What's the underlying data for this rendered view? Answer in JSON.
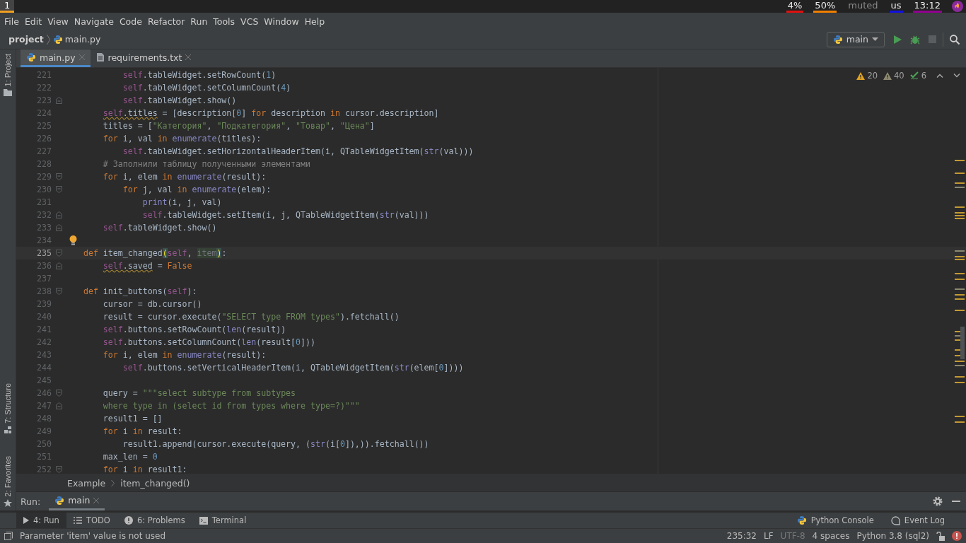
{
  "system_bar": {
    "workspaces": [
      {
        "label": "1",
        "selected": true
      }
    ],
    "indicators": [
      {
        "text": "4%",
        "color": "#e01010"
      },
      {
        "text": "50%",
        "color": "#f08000"
      },
      {
        "text": "muted"
      },
      {
        "text": "us",
        "color": "#1010e0"
      },
      {
        "text": "13:12",
        "color": "#900090"
      }
    ]
  },
  "menu": [
    "File",
    "Edit",
    "View",
    "Navigate",
    "Code",
    "Refactor",
    "Run",
    "Tools",
    "VCS",
    "Window",
    "Help"
  ],
  "nav": {
    "project": "project",
    "file": "main.py",
    "run_config": "main",
    "stop_disabled": true
  },
  "tabs": [
    {
      "label": "main.py",
      "kind": "python",
      "selected": true
    },
    {
      "label": "requirements.txt",
      "kind": "text",
      "selected": false
    }
  ],
  "left_stripe": [
    {
      "label": "1: Project",
      "kind": "project"
    },
    {
      "label": "7: Structure",
      "kind": "structure"
    },
    {
      "label": "2: Favorites",
      "kind": "favorites"
    }
  ],
  "inspections": [
    {
      "kind": "warning",
      "count": "20"
    },
    {
      "kind": "weak",
      "count": "40"
    },
    {
      "kind": "typo",
      "count": "6"
    }
  ],
  "code": [
    {
      "number": "221",
      "tokens": [
        {
          "kind": "self",
          "text": "            self"
        },
        {
          "kind": "plain",
          "text": ".tableWidget.setRowCount("
        },
        {
          "kind": "number",
          "text": "1"
        },
        {
          "kind": "plain",
          "text": ")"
        }
      ]
    },
    {
      "number": "222",
      "tokens": [
        {
          "kind": "self",
          "text": "            self"
        },
        {
          "kind": "plain",
          "text": ".tableWidget.setColumnCount("
        },
        {
          "kind": "number",
          "text": "4"
        },
        {
          "kind": "plain",
          "text": ")"
        }
      ]
    },
    {
      "number": "223",
      "fold_end": true,
      "tokens": [
        {
          "kind": "self",
          "text": "            self"
        },
        {
          "kind": "plain",
          "text": ".tableWidget.show()"
        }
      ]
    },
    {
      "number": "224",
      "tokens": [
        {
          "kind": "self",
          "text": "        self",
          "warning": true
        },
        {
          "kind": "plain",
          "text": ".titles",
          "warning": true
        },
        {
          "kind": "plain",
          "text": " = [description["
        },
        {
          "kind": "number",
          "text": "0"
        },
        {
          "kind": "plain",
          "text": "] "
        },
        {
          "kind": "keyword",
          "text": "for"
        },
        {
          "kind": "plain",
          "text": " description "
        },
        {
          "kind": "keyword",
          "text": "in"
        },
        {
          "kind": "plain",
          "text": " cursor.description]"
        }
      ]
    },
    {
      "number": "225",
      "tokens": [
        {
          "kind": "plain",
          "text": "        titles = ["
        },
        {
          "kind": "string",
          "text": "\"Категория\""
        },
        {
          "kind": "plain",
          "text": ", "
        },
        {
          "kind": "string",
          "text": "\"Подкатегория\""
        },
        {
          "kind": "plain",
          "text": ", "
        },
        {
          "kind": "string",
          "text": "\"Товар\""
        },
        {
          "kind": "plain",
          "text": ", "
        },
        {
          "kind": "string",
          "text": "\"Цена\""
        },
        {
          "kind": "plain",
          "text": "]"
        }
      ]
    },
    {
      "number": "226",
      "tokens": [
        {
          "kind": "keyword",
          "text": "        for"
        },
        {
          "kind": "plain",
          "text": " i, val "
        },
        {
          "kind": "keyword",
          "text": "in"
        },
        {
          "kind": "builtin",
          "text": " enumerate"
        },
        {
          "kind": "plain",
          "text": "(titles):"
        }
      ]
    },
    {
      "number": "227",
      "tokens": [
        {
          "kind": "self",
          "text": "            self"
        },
        {
          "kind": "plain",
          "text": ".tableWidget.setHorizontalHeaderItem(i, QTableWidgetItem("
        },
        {
          "kind": "builtin",
          "text": "str"
        },
        {
          "kind": "plain",
          "text": "(val)))"
        }
      ]
    },
    {
      "number": "228",
      "tokens": [
        {
          "kind": "comment",
          "text": "        # Заполнили таблицу полученными элементами"
        }
      ]
    },
    {
      "number": "229",
      "fold_start": true,
      "tokens": [
        {
          "kind": "keyword",
          "text": "        for"
        },
        {
          "kind": "plain",
          "text": " i, elem "
        },
        {
          "kind": "keyword",
          "text": "in"
        },
        {
          "kind": "builtin",
          "text": " enumerate"
        },
        {
          "kind": "plain",
          "text": "(result):"
        }
      ]
    },
    {
      "number": "230",
      "fold_start": true,
      "tokens": [
        {
          "kind": "keyword",
          "text": "            for"
        },
        {
          "kind": "plain",
          "text": " j, val "
        },
        {
          "kind": "keyword",
          "text": "in"
        },
        {
          "kind": "builtin",
          "text": " enumerate"
        },
        {
          "kind": "plain",
          "text": "(elem):"
        }
      ]
    },
    {
      "number": "231",
      "tokens": [
        {
          "kind": "builtin",
          "text": "                print"
        },
        {
          "kind": "plain",
          "text": "(i, j, val)"
        }
      ]
    },
    {
      "number": "232",
      "fold_end": true,
      "tokens": [
        {
          "kind": "self",
          "text": "                self"
        },
        {
          "kind": "plain",
          "text": ".tableWidget.setItem(i, j, QTableWidgetItem("
        },
        {
          "kind": "builtin",
          "text": "str"
        },
        {
          "kind": "plain",
          "text": "(val)))"
        }
      ]
    },
    {
      "number": "233",
      "fold_end": true,
      "tokens": [
        {
          "kind": "self",
          "text": "        self"
        },
        {
          "kind": "plain",
          "text": ".tableWidget.show()"
        }
      ]
    },
    {
      "number": "234",
      "bulb": true
    },
    {
      "number": "235",
      "fold_start": true,
      "current": true,
      "tokens": [
        {
          "kind": "keyword",
          "text": "    def"
        },
        {
          "kind": "plain",
          "text": " item_changed"
        },
        {
          "kind": "brace_match",
          "text": "("
        },
        {
          "kind": "self",
          "text": "self"
        },
        {
          "kind": "plain",
          "text": ", "
        },
        {
          "kind": "unused",
          "text": "item"
        },
        {
          "kind": "brace_match",
          "text": ")"
        },
        {
          "kind": "plain",
          "text": ":"
        }
      ]
    },
    {
      "number": "236",
      "fold_end": true,
      "tokens": [
        {
          "kind": "self",
          "text": "        self",
          "warning": true
        },
        {
          "kind": "plain",
          "text": ".saved",
          "warning": true
        },
        {
          "kind": "plain",
          "text": " = "
        },
        {
          "kind": "keyword",
          "text": "False"
        }
      ]
    },
    {
      "number": "237"
    },
    {
      "number": "238",
      "fold_start": true,
      "tokens": [
        {
          "kind": "keyword",
          "text": "    def"
        },
        {
          "kind": "plain",
          "text": " init_buttons("
        },
        {
          "kind": "self",
          "text": "self"
        },
        {
          "kind": "plain",
          "text": "):"
        }
      ]
    },
    {
      "number": "239",
      "tokens": [
        {
          "kind": "plain",
          "text": "        cursor = db.cursor()"
        }
      ]
    },
    {
      "number": "240",
      "tokens": [
        {
          "kind": "plain",
          "text": "        result = cursor.execute("
        },
        {
          "kind": "string",
          "text": "\"SELECT type FROM types\""
        },
        {
          "kind": "plain",
          "text": ").fetchall()"
        }
      ]
    },
    {
      "number": "241",
      "tokens": [
        {
          "kind": "self",
          "text": "        self"
        },
        {
          "kind": "plain",
          "text": ".buttons.setRowCount("
        },
        {
          "kind": "builtin",
          "text": "len"
        },
        {
          "kind": "plain",
          "text": "(result))"
        }
      ]
    },
    {
      "number": "242",
      "tokens": [
        {
          "kind": "self",
          "text": "        self"
        },
        {
          "kind": "plain",
          "text": ".buttons.setColumnCount("
        },
        {
          "kind": "builtin",
          "text": "len"
        },
        {
          "kind": "plain",
          "text": "(result["
        },
        {
          "kind": "number",
          "text": "0"
        },
        {
          "kind": "plain",
          "text": "]))"
        }
      ]
    },
    {
      "number": "243",
      "tokens": [
        {
          "kind": "keyword",
          "text": "        for"
        },
        {
          "kind": "plain",
          "text": " i, elem "
        },
        {
          "kind": "keyword",
          "text": "in"
        },
        {
          "kind": "builtin",
          "text": " enumerate"
        },
        {
          "kind": "plain",
          "text": "(result):"
        }
      ]
    },
    {
      "number": "244",
      "tokens": [
        {
          "kind": "self",
          "text": "            self"
        },
        {
          "kind": "plain",
          "text": ".buttons.setVerticalHeaderItem(i, QTableWidgetItem("
        },
        {
          "kind": "builtin",
          "text": "str"
        },
        {
          "kind": "plain",
          "text": "(elem["
        },
        {
          "kind": "number",
          "text": "0"
        },
        {
          "kind": "plain",
          "text": "])))"
        }
      ]
    },
    {
      "number": "245"
    },
    {
      "number": "246",
      "fold_start": true,
      "tokens": [
        {
          "kind": "plain",
          "text": "        query = "
        },
        {
          "kind": "string",
          "text": "\"\"\"select subtype from subtypes"
        }
      ]
    },
    {
      "number": "247",
      "fold_end": true,
      "tokens": [
        {
          "kind": "string",
          "text": "        where type in (select id from types where type=?)\"\"\""
        }
      ]
    },
    {
      "number": "248",
      "tokens": [
        {
          "kind": "plain",
          "text": "        result1 = []"
        }
      ]
    },
    {
      "number": "249",
      "tokens": [
        {
          "kind": "keyword",
          "text": "        for"
        },
        {
          "kind": "plain",
          "text": " i "
        },
        {
          "kind": "keyword",
          "text": "in"
        },
        {
          "kind": "plain",
          "text": " result:"
        }
      ]
    },
    {
      "number": "250",
      "tokens": [
        {
          "kind": "plain",
          "text": "            result1.append(cursor.execute(query, ("
        },
        {
          "kind": "builtin",
          "text": "str"
        },
        {
          "kind": "plain",
          "text": "(i["
        },
        {
          "kind": "number",
          "text": "0"
        },
        {
          "kind": "plain",
          "text": "]),)).fetchall())"
        }
      ]
    },
    {
      "number": "251",
      "tokens": [
        {
          "kind": "plain",
          "text": "        max_len = "
        },
        {
          "kind": "number",
          "text": "0"
        }
      ]
    },
    {
      "number": "252",
      "fold_start": true,
      "tokens": [
        {
          "kind": "keyword",
          "text": "        for"
        },
        {
          "kind": "plain",
          "text": " i "
        },
        {
          "kind": "keyword",
          "text": "in"
        },
        {
          "kind": "plain",
          "text": " result1:"
        }
      ]
    }
  ],
  "breadcrumb": [
    "Example",
    "item_changed()"
  ],
  "run_panel": {
    "label": "Run:",
    "tab": "main"
  },
  "tool_windows": [
    {
      "label": "4: Run",
      "kind": "run",
      "selected": true
    },
    {
      "label": "TODO",
      "kind": "todo",
      "selected": false
    },
    {
      "label": "6: Problems",
      "kind": "problems",
      "selected": false
    },
    {
      "label": "Terminal",
      "kind": "terminal",
      "selected": false
    }
  ],
  "tool_windows_right": [
    {
      "label": "Python Console",
      "kind": "python"
    },
    {
      "label": "Event Log",
      "kind": "log"
    }
  ],
  "status": {
    "message": "Parameter 'item' value is not used",
    "items": [
      {
        "text": "235:32",
        "dimmed": false
      },
      {
        "text": "LF",
        "dimmed": false
      },
      {
        "text": "UTF-8",
        "dimmed": true
      },
      {
        "text": "4 spaces",
        "dimmed": false
      },
      {
        "text": "Python 3.8 (sql2)",
        "dimmed": false
      }
    ]
  }
}
